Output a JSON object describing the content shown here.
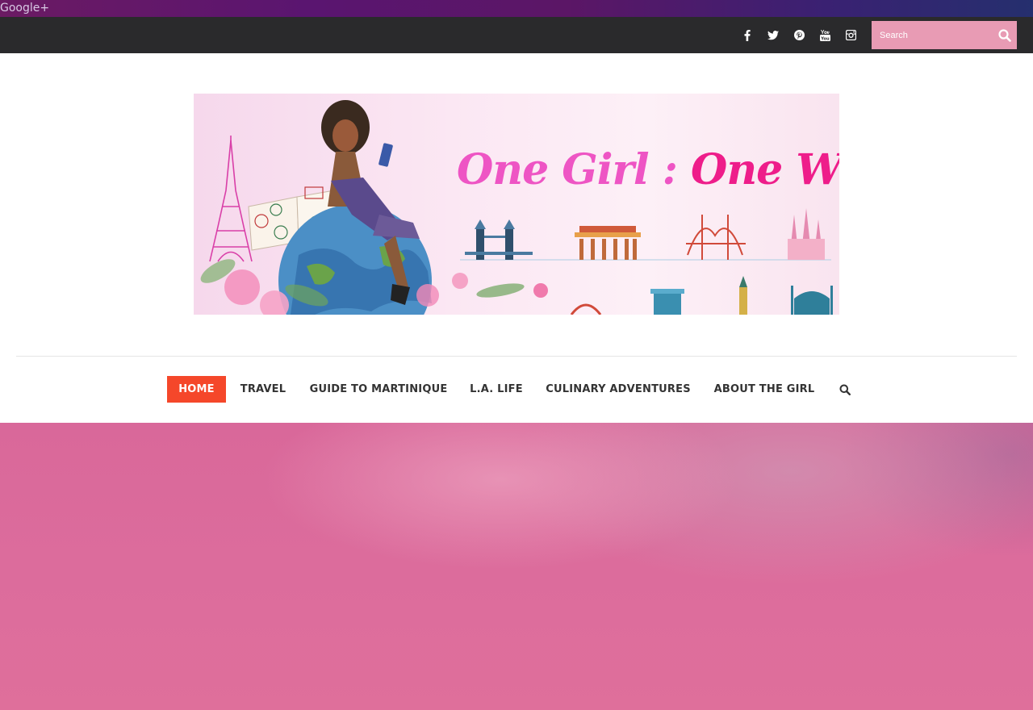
{
  "topstrip": {
    "gplus_label": "Google+"
  },
  "topbar": {
    "social_icons": [
      "facebook-icon",
      "twitter-icon",
      "pinterest-icon",
      "youtube-icon",
      "instagram-icon"
    ],
    "search": {
      "placeholder": "Search",
      "value": ""
    }
  },
  "banner": {
    "title_part1": "One Girl :",
    "title_part2": "One World"
  },
  "nav": {
    "items": [
      {
        "label": "HOME",
        "active": true
      },
      {
        "label": "TRAVEL",
        "active": false
      },
      {
        "label": "GUIDE TO MARTINIQUE",
        "active": false
      },
      {
        "label": "L.A. LIFE",
        "active": false
      },
      {
        "label": "CULINARY ADVENTURES",
        "active": false
      },
      {
        "label": "ABOUT THE GIRL",
        "active": false
      }
    ]
  },
  "colors": {
    "topbar_bg": "#2a2a2c",
    "search_bg": "#e89bb4",
    "nav_active_bg": "#f5472a",
    "hero_pink": "#dc6c9c",
    "title_pink_light": "#ee55c4",
    "title_pink": "#ee1d8a"
  }
}
